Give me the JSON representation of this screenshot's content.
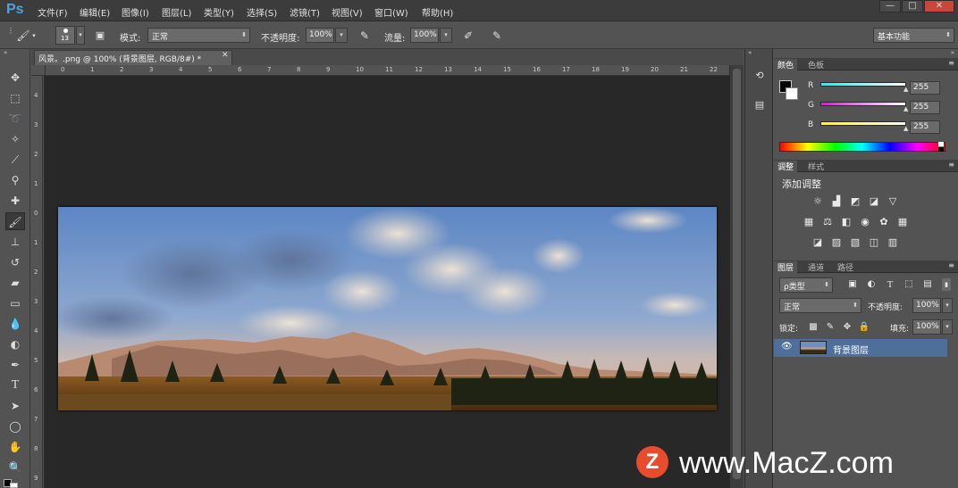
{
  "app": {
    "logo": "Ps"
  },
  "menubar": {
    "items": [
      "文件(F)",
      "编辑(E)",
      "图像(I)",
      "图层(L)",
      "类型(Y)",
      "选择(S)",
      "滤镜(T)",
      "视图(V)",
      "窗口(W)",
      "帮助(H)"
    ],
    "window_buttons": [
      "—",
      "□",
      "✕"
    ]
  },
  "options": {
    "brush_size": "13",
    "mode_label": "模式:",
    "mode_value": "正常",
    "opacity_label": "不透明度:",
    "opacity_value": "100%",
    "flow_label": "流量:",
    "flow_value": "100%",
    "workspace": "基本功能"
  },
  "document": {
    "tab_title": "风景。.png @ 100% (背景图层, RGB/8#) *",
    "close": "✕",
    "hruler_ticks": [
      "0",
      "1",
      "2",
      "3",
      "4",
      "5",
      "6",
      "7",
      "8",
      "9",
      "10",
      "11",
      "12",
      "13",
      "14",
      "15",
      "16",
      "17",
      "18",
      "19",
      "20",
      "21",
      "22"
    ],
    "vruler_ticks": [
      "4",
      "3",
      "2",
      "1",
      "0",
      "1",
      "2",
      "3",
      "4",
      "5",
      "6",
      "7",
      "8",
      "9"
    ]
  },
  "color_panel": {
    "tabs": [
      "颜色",
      "色板"
    ],
    "r_label": "R",
    "r_value": "255",
    "g_label": "G",
    "g_value": "255",
    "b_label": "B",
    "b_value": "255"
  },
  "adjust_panel": {
    "tabs": [
      "调整",
      "样式"
    ],
    "title": "添加调整"
  },
  "layers_panel": {
    "tabs": [
      "图层",
      "通道",
      "路径"
    ],
    "filter": "ρ类型",
    "blend": "正常",
    "opacity_label": "不透明度:",
    "opacity_value": "100%",
    "lock_label": "锁定:",
    "fill_label": "填充:",
    "fill_value": "100%",
    "layer_name": "背景图层"
  },
  "watermark": {
    "logo": "Z",
    "text": "www.MacZ.com"
  },
  "colors": {
    "accent": "#4fa3e0",
    "watermark_red": "#e74c2c"
  }
}
